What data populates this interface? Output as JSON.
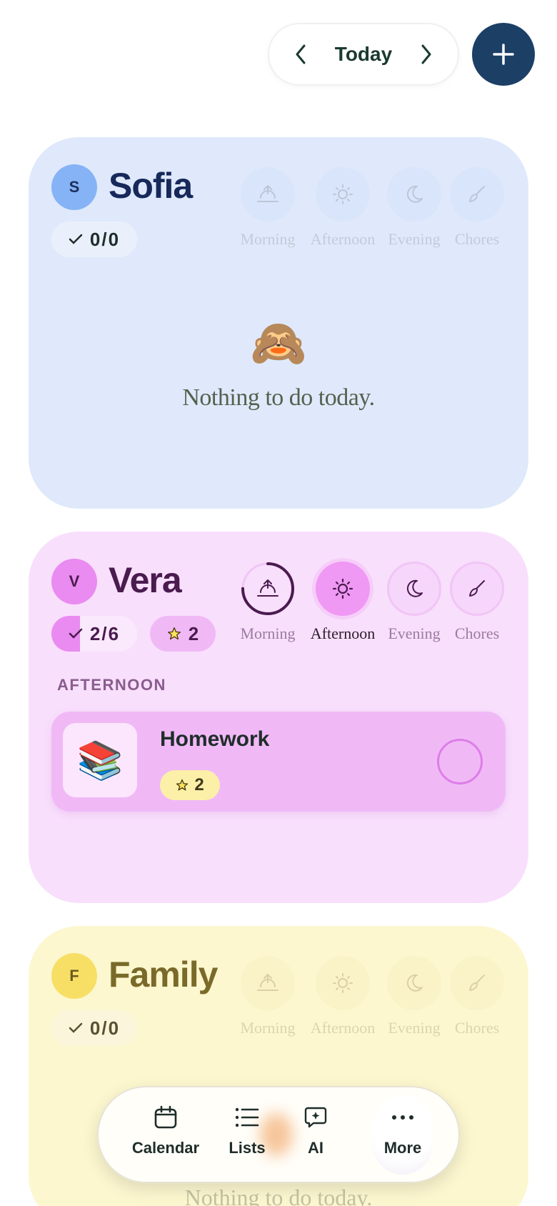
{
  "header": {
    "date_label": "Today",
    "prev_icon": "chevron-left-icon",
    "next_icon": "chevron-right-icon",
    "add_icon": "plus-icon",
    "add_color": "#1c3f66"
  },
  "periods": [
    "Morning",
    "Afternoon",
    "Evening",
    "Chores"
  ],
  "sofia": {
    "initial": "S",
    "name": "Sofia",
    "count": "0/0",
    "empty_emoji": "🙈",
    "empty_message": "Nothing to do today.",
    "color": "#dfe9fb"
  },
  "vera": {
    "initial": "V",
    "name": "Vera",
    "count": "2/6",
    "progress_fraction": 0.333,
    "stars": "2",
    "active_period": "Afternoon",
    "morning_progress_fraction": 0.75,
    "section_heading": "AFTERNOON",
    "task": {
      "emoji": "📚",
      "title": "Homework",
      "reward": "2"
    },
    "color": "#f8dffc"
  },
  "family": {
    "initial": "F",
    "name": "Family",
    "count": "0/0",
    "empty_message": "Nothing to do today.",
    "color": "#fcf7cf"
  },
  "bottom_nav": {
    "items": [
      {
        "label": "Calendar",
        "icon": "calendar-icon"
      },
      {
        "label": "Lists",
        "icon": "list-icon"
      },
      {
        "label": "AI",
        "icon": "ai-chat-icon"
      },
      {
        "label": "More",
        "icon": "more-icon"
      }
    ]
  }
}
